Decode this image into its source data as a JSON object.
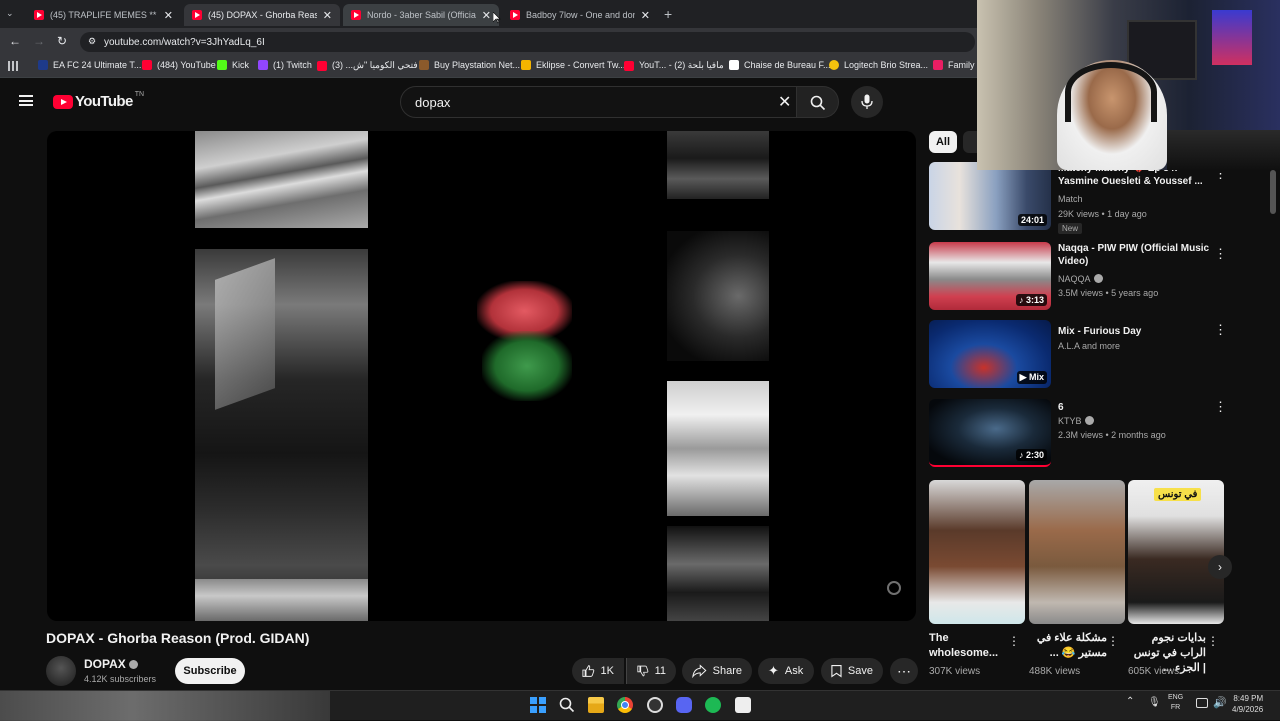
{
  "browser": {
    "tabs": [
      {
        "title": "(45) TRAPLIFE MEMES ** ZGOU",
        "active": false
      },
      {
        "title": "(45) DOPAX - Ghorba Reason (I",
        "active": true
      },
      {
        "title": "Nordo - 3aber Sabil (Official M",
        "active": false
      },
      {
        "title": "Badboy 7low - One and done (",
        "active": false
      }
    ],
    "url": "youtube.com/watch?v=3JhYadLq_6I",
    "bookmarks": [
      {
        "label": "EA FC 24 Ultimate T...",
        "color": "#1e3a8a"
      },
      {
        "label": "(484) YouTube",
        "color": "#ff0033"
      },
      {
        "label": "Kick",
        "color": "#53fc18"
      },
      {
        "label": "(1) Twitch",
        "color": "#9146ff"
      },
      {
        "label": "فتحي الكوميا \"ش... (3)",
        "color": "#ff0033"
      },
      {
        "label": "Buy Playstation Net...",
        "color": "#8b5a2b"
      },
      {
        "label": "Eklipse - Convert Tw...",
        "color": "#f4b400"
      },
      {
        "label": "YouT... - مافيا بلحة (2)",
        "color": "#ff0033"
      },
      {
        "label": "Chaise de Bureau F...",
        "color": "#ffffff"
      },
      {
        "label": "Logitech Brio Strea...",
        "color": "#f4c20d"
      },
      {
        "label": "Family F",
        "color": "#e91e63"
      }
    ]
  },
  "youtube": {
    "logo_text": "YouTube",
    "logo_sup": "TN",
    "search_value": "dopax",
    "video": {
      "title": "DOPAX - Ghorba Reason (Prod. GIDAN)",
      "channel": "DOPAX",
      "subscribers": "4.12K subscribers",
      "subscribe_label": "Subscribe",
      "likes": "1K",
      "dislikes": "11",
      "share_label": "Share",
      "ask_label": "Ask",
      "save_label": "Save"
    },
    "chips": {
      "all": "All"
    },
    "recommendations": [
      {
        "title": "Matchy Matchy 💔 Ep 34: Yasmine Ouesleti & Youssef ...",
        "channel": "Match",
        "meta": "29K views • 1 day ago",
        "duration": "24:01",
        "badge": "New"
      },
      {
        "title": "Naqqa - PIW PIW (Official Music Video)",
        "channel": "NAQQA",
        "meta": "3.5M views • 5 years ago",
        "duration": "3:13"
      },
      {
        "title": "Mix - Furious Day",
        "channel": "A.L.A and more",
        "meta": "",
        "duration": "Mix"
      },
      {
        "title": "6",
        "channel": "KTYB",
        "meta": "2.3M views • 2 months ago",
        "duration": "2:30"
      }
    ],
    "shorts": [
      {
        "title": "The wholesome...",
        "views": "307K views"
      },
      {
        "title": "مشكلة علاء في مستير 😂 ...",
        "views": "488K views"
      },
      {
        "title": "بدايات نجوم الراب في تونس | الجزء ...",
        "views": "605K views"
      }
    ],
    "short_overlay_text": "في تونس"
  },
  "taskbar": {
    "lang": "ENG",
    "lang2": "FR",
    "time": "8:49 PM",
    "date": "4/9/2026"
  }
}
